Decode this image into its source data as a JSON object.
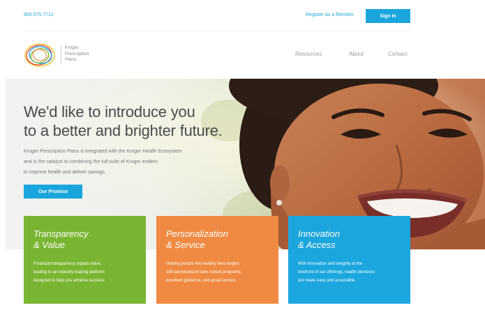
{
  "header": {
    "phone": "800.575.7712",
    "register_label": "Register as a Member",
    "signin_label": "Sign In"
  },
  "logo": {
    "line1": "Kroger",
    "line2": "Prescription",
    "line3": "Plans",
    "ring_colors": [
      "#7ab532",
      "#f08a42",
      "#1ba6dd",
      "#e2433f",
      "#f2c318"
    ]
  },
  "nav": {
    "items": [
      {
        "label": "Resources"
      },
      {
        "label": "About"
      },
      {
        "label": "Contact"
      }
    ]
  },
  "hero": {
    "title_line1": "We'd like to introduce you",
    "title_line2": "to a better and brighter future.",
    "copy_line1": "Kroger Prescription Plans is integrated with the Kroger Health Ecosystem",
    "copy_line2": "and is the catalyst to combining the full suite of Kroger entities",
    "copy_line3": "to improve health and deliver savings.",
    "button_label": "Our Promise"
  },
  "cards": [
    {
      "title_line1": "Transparency",
      "title_line2": "& Value",
      "body_line1": "Financial transparency equals value,",
      "body_line2": "leading to an industry-leading platform",
      "body_line3": "designed to help you achieve success.",
      "color": "#7ab532"
    },
    {
      "title_line1": "Personalization",
      "title_line2": "& Service",
      "body_line1": "Helping people live healthy lives begins",
      "body_line2": "with personalized care, robust programs,",
      "body_line3": "excellent guidance, and great service.",
      "color": "#f08a42"
    },
    {
      "title_line1": "Innovation",
      "title_line2": "& Access",
      "body_line1": "With innovation and integrity at the",
      "body_line2": "forefront of our offerings, health decisions",
      "body_line3": "are made easy and accessible.",
      "color": "#1ba6dd"
    }
  ],
  "colors": {
    "accent": "#1aa6dd",
    "text_dark": "#4a4a4a"
  }
}
